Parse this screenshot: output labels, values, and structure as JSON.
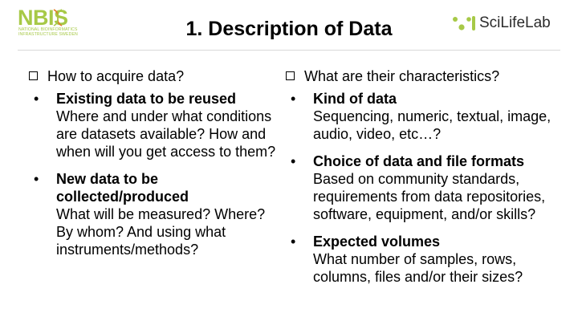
{
  "logos": {
    "nbis_word": "NBIS",
    "nbis_subtitle_line1": "NATIONAL BIOINFORMATICS",
    "nbis_subtitle_line2": "INFRASTRUCTURE SWEDEN",
    "scilifelab_text": "SciLifeLab",
    "nbis_color": "#a7c947",
    "scilifelab_accent": "#a7c947"
  },
  "title": "1. Description of Data",
  "left": {
    "heading": "How to acquire data?",
    "items": [
      {
        "bullet": "•",
        "title": "Existing data to be reused",
        "desc": "Where and under what conditions are datasets available? How and when will you get access to them?"
      },
      {
        "bullet": "•",
        "title": "New data to be collected/produced",
        "desc": "What will be measured? Where? By whom? And using what instruments/methods?"
      }
    ]
  },
  "right": {
    "heading": "What are their characteristics?",
    "items": [
      {
        "bullet": "•",
        "title": "Kind of data",
        "desc": "Sequencing, numeric, textual, image, audio, video, etc…?"
      },
      {
        "bullet": "•",
        "title": "Choice of data and file formats",
        "desc": "Based on community standards, requirements from data repositories, software, equipment, and/or skills?"
      },
      {
        "bullet": "•",
        "title": "Expected volumes",
        "desc": "What number of samples, rows, columns, files and/or their sizes?"
      }
    ]
  }
}
